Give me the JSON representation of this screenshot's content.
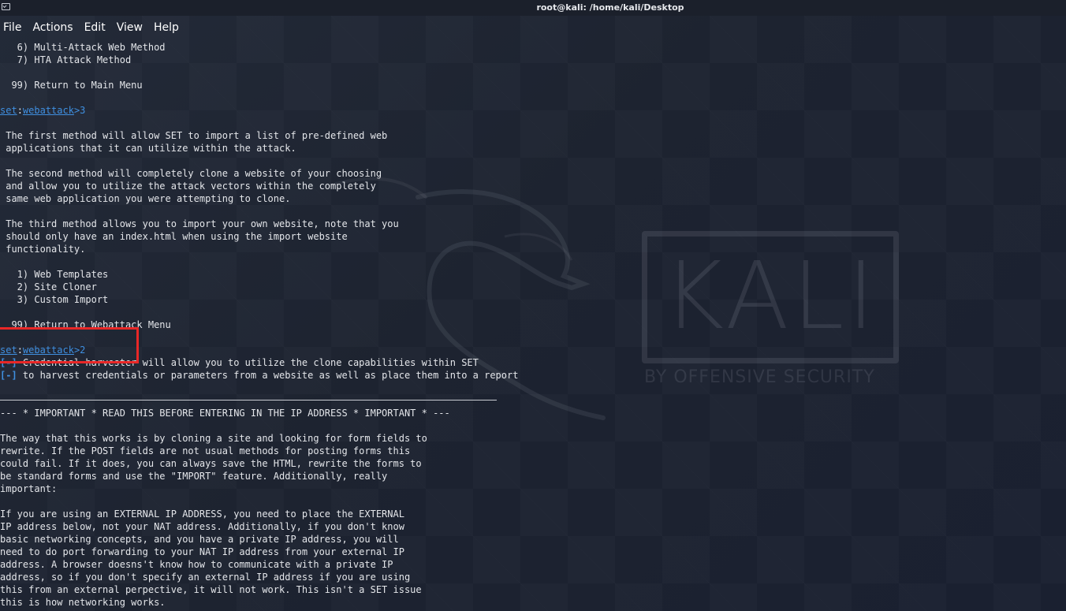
{
  "window": {
    "title": "root@kali: /home/kali/Desktop"
  },
  "menu": {
    "items": [
      "File",
      "Actions",
      "Edit",
      "View",
      "Help"
    ]
  },
  "terminal": {
    "lines": [
      {
        "text": "   6) Multi-Attack Web Method"
      },
      {
        "text": "   7) HTA Attack Method"
      },
      {
        "text": ""
      },
      {
        "text": "  99) Return to Main Menu"
      },
      {
        "text": ""
      },
      {
        "prompt": true,
        "p1": "set",
        "p2": ":",
        "p3": "webattack",
        "p4": ">3"
      },
      {
        "text": ""
      },
      {
        "text": " The first method will allow SET to import a list of pre-defined web"
      },
      {
        "text": " applications that it can utilize within the attack."
      },
      {
        "text": ""
      },
      {
        "text": " The second method will completely clone a website of your choosing"
      },
      {
        "text": " and allow you to utilize the attack vectors within the completely"
      },
      {
        "text": " same web application you were attempting to clone."
      },
      {
        "text": ""
      },
      {
        "text": " The third method allows you to import your own website, note that you"
      },
      {
        "text": " should only have an index.html when using the import website"
      },
      {
        "text": " functionality."
      },
      {
        "text": ""
      },
      {
        "text": "   1) Web Templates"
      },
      {
        "text": "   2) Site Cloner"
      },
      {
        "text": "   3) Custom Import"
      },
      {
        "text": ""
      },
      {
        "text": "  99) Return to Webattack Menu"
      },
      {
        "text": ""
      },
      {
        "prompt": true,
        "p1": "set",
        "p2": ":",
        "p3": "webattack",
        "p4": ">2"
      },
      {
        "bullet": "[-]",
        "text": " Credential harvester will allow you to utilize the clone capabilities within SET"
      },
      {
        "bullet": "[-]",
        "text": " to harvest credentials or parameters from a website as well as place them into a report"
      },
      {
        "text": ""
      },
      {
        "separator": true
      },
      {
        "text": "--- * IMPORTANT * READ THIS BEFORE ENTERING IN THE IP ADDRESS * IMPORTANT * ---"
      },
      {
        "text": ""
      },
      {
        "text": "The way that this works is by cloning a site and looking for form fields to"
      },
      {
        "text": "rewrite. If the POST fields are not usual methods for posting forms this"
      },
      {
        "text": "could fail. If it does, you can always save the HTML, rewrite the forms to"
      },
      {
        "text": "be standard forms and use the \"IMPORT\" feature. Additionally, really"
      },
      {
        "text": "important:"
      },
      {
        "text": ""
      },
      {
        "text": "If you are using an EXTERNAL IP ADDRESS, you need to place the EXTERNAL"
      },
      {
        "text": "IP address below, not your NAT address. Additionally, if you don't know"
      },
      {
        "text": "basic networking concepts, and you have a private IP address, you will"
      },
      {
        "text": "need to do port forwarding to your NAT IP address from your external IP"
      },
      {
        "text": "address. A browser doesns't know how to communicate with a private IP"
      },
      {
        "text": "address, so if you don't specify an external IP address if you are using"
      },
      {
        "text": "this from an external perpective, it will not work. This isn't a SET issue"
      },
      {
        "text": "this is how networking works."
      }
    ]
  },
  "watermark": {
    "logo_text": "KALI",
    "subtitle": "BY OFFENSIVE SECURITY"
  },
  "colors": {
    "prompt_blue": "#3f8fe0",
    "highlight_red": "#e82727",
    "background": "#1d2330"
  }
}
